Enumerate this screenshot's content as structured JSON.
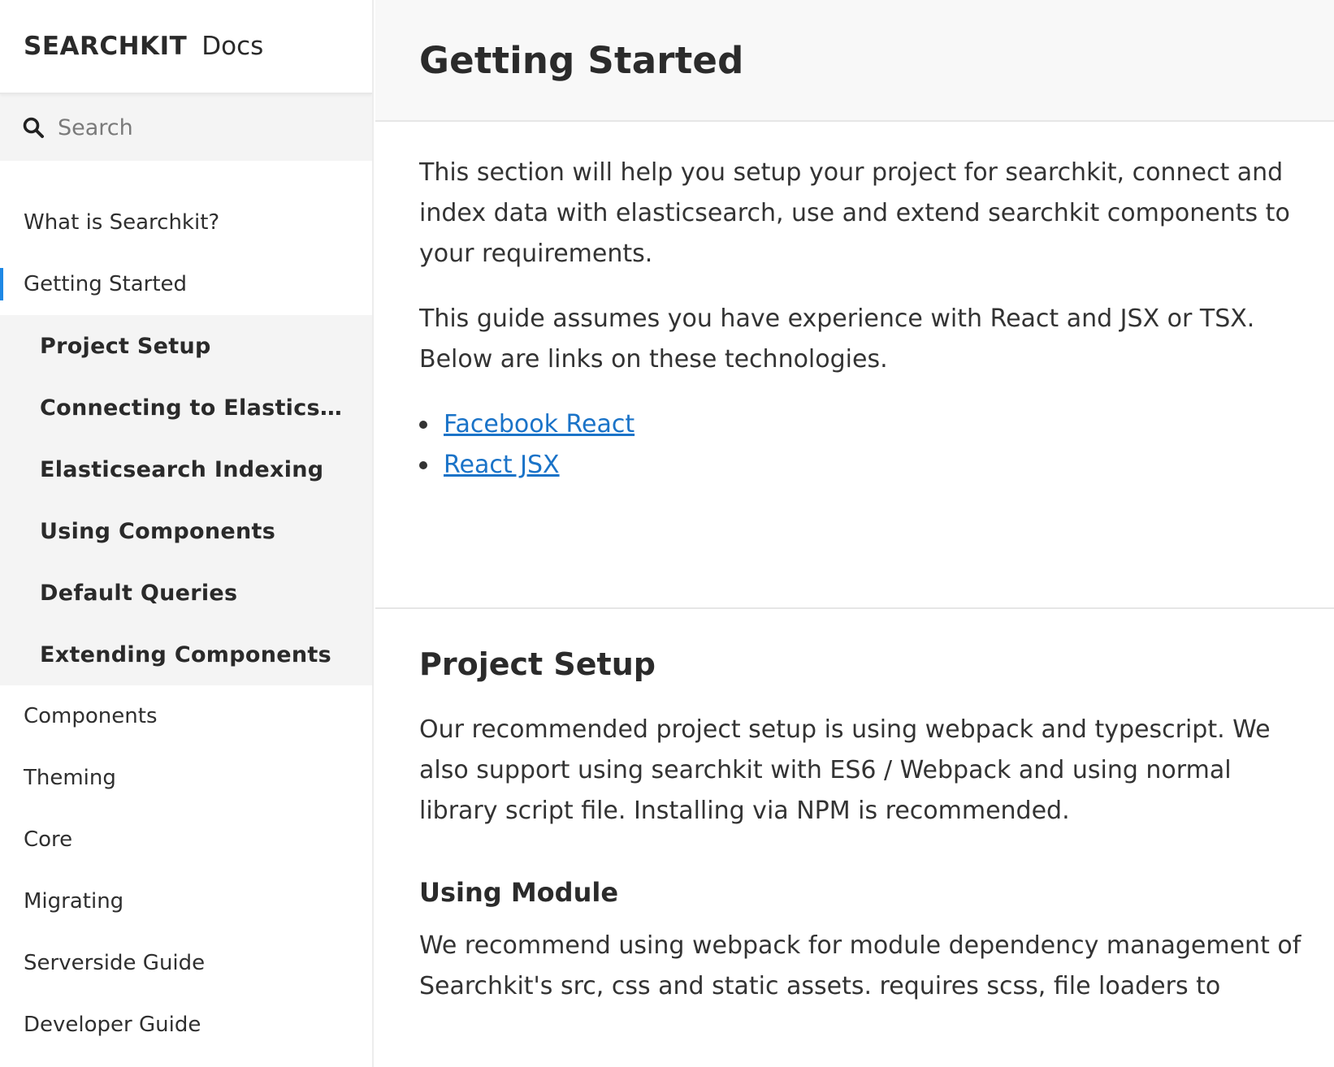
{
  "brand": {
    "name": "SEARCHKIT",
    "suffix": "Docs"
  },
  "search": {
    "placeholder": "Search",
    "icon": "search-icon"
  },
  "nav": {
    "before": [
      {
        "label": "What is Searchkit?"
      }
    ],
    "active": {
      "label": "Getting Started"
    },
    "sub": [
      {
        "label": "Project Setup"
      },
      {
        "label": "Connecting to Elasticsearch"
      },
      {
        "label": "Elasticsearch Indexing"
      },
      {
        "label": "Using Components"
      },
      {
        "label": "Default Queries"
      },
      {
        "label": "Extending Components"
      }
    ],
    "after": [
      {
        "label": "Components"
      },
      {
        "label": "Theming"
      },
      {
        "label": "Core"
      },
      {
        "label": "Migrating"
      },
      {
        "label": "Serverside Guide"
      },
      {
        "label": "Developer Guide"
      }
    ]
  },
  "page": {
    "title": "Getting Started",
    "intro": "This section will help you setup your project for searchkit, connect and index data with elasticsearch, use and extend searchkit components to your requirements.",
    "assumption": "This guide assumes you have experience with React and JSX or TSX. Below are links on these technologies.",
    "links": [
      {
        "label": "Facebook React"
      },
      {
        "label": "React JSX"
      }
    ]
  },
  "project_setup": {
    "heading": "Project Setup",
    "text": "Our recommended project setup is using webpack and typescript. We also support using searchkit with ES6 / Webpack and using normal library script file. Installing via NPM is recommended.",
    "subheading": "Using Module",
    "module_text": "We recommend using webpack for module dependency management of Searchkit's src, css and static assets. requires scss, file loaders to"
  },
  "colors": {
    "accent": "#1e88e5",
    "link": "#1a73c8",
    "sidebar_sub_bg": "#f4f4f4"
  }
}
